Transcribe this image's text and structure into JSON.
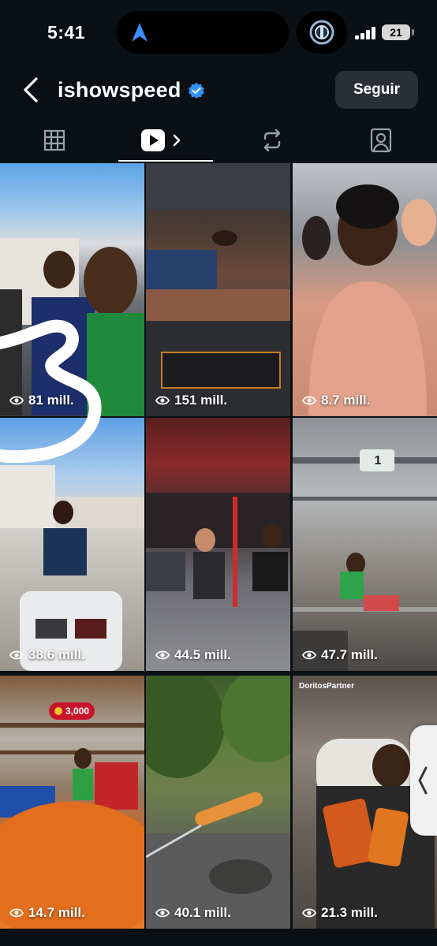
{
  "status_bar": {
    "time": "5:41",
    "battery": "21"
  },
  "header": {
    "username": "ishowspeed",
    "follow_label": "Seguir"
  },
  "tabs": [
    {
      "name": "grid",
      "icon": "grid-icon"
    },
    {
      "name": "reels",
      "icon": "reels-icon",
      "active": true
    },
    {
      "name": "reposts",
      "icon": "repost-icon"
    },
    {
      "name": "tagged",
      "icon": "tagged-icon"
    }
  ],
  "posts": [
    {
      "views": "81 mill."
    },
    {
      "views": "151 mill."
    },
    {
      "views": "8.7 mill."
    },
    {
      "views": "38.6 mill."
    },
    {
      "views": "44.5 mill."
    },
    {
      "views": "47.7 mill."
    },
    {
      "views": "14.7 mill.",
      "badge": "3,000"
    },
    {
      "views": "40.1 mill."
    },
    {
      "views": "21.3 mill.",
      "partner": "DoritosPartner"
    }
  ],
  "colors": {
    "background": "#0b1014",
    "verified": "#2f93f5",
    "follow_bg": "#2a2f36"
  }
}
